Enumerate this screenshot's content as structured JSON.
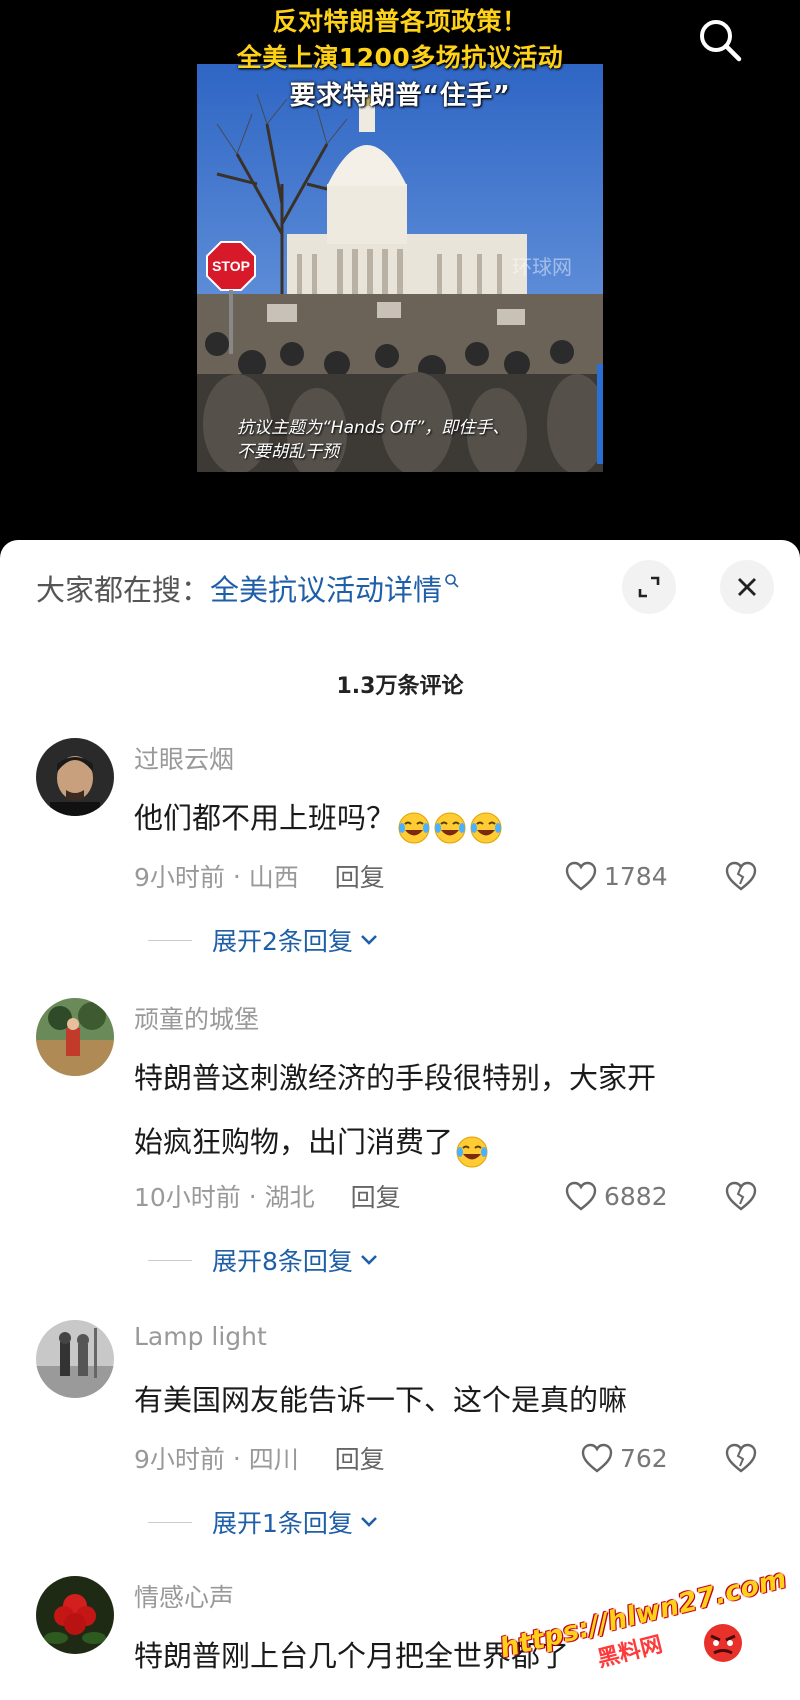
{
  "video": {
    "headline_lines": [
      "反对特朗普各项政策！",
      "全美上演1200多场抗议活动",
      "要求特朗普“住手”"
    ],
    "caption_lines": [
      "抗议主题为“Hands Off”，即住手、",
      "不要胡乱干预"
    ],
    "sign_text": "STOP",
    "watermark_text": "环球网"
  },
  "trending": {
    "label": "大家都在搜：",
    "query": "全美抗议活动详情"
  },
  "comments_header": "1.3万条评论",
  "comments": [
    {
      "user": "过眼云烟",
      "text": "他们都不用上班吗？",
      "emoji": [
        "laugh-cry",
        "laugh-cry",
        "laugh-cry"
      ],
      "time": "9小时前",
      "location": "山西",
      "reply_label": "回复",
      "likes": "1784",
      "expand_label": "展开2条回复"
    },
    {
      "user": "顽童的城堡",
      "text_lines": [
        "特朗普这刺激经济的手段很特别，大家开",
        "始疯狂购物，出门消费了"
      ],
      "emoji": [
        "laugh-cry"
      ],
      "time": "10小时前",
      "location": "湖北",
      "reply_label": "回复",
      "likes": "6882",
      "expand_label": "展开8条回复"
    },
    {
      "user": "Lamp light",
      "text": "有美国网友能告诉一下、这个是真的嘛",
      "time": "9小时前",
      "location": "四川",
      "reply_label": "回复",
      "likes": "762",
      "expand_label": "展开1条回复"
    },
    {
      "user": "情感心声",
      "text": "特朗普刚上台几个月把全世界都",
      "text_tail": "了"
    }
  ],
  "overlay_watermark": {
    "url": "https://hlwn27.com",
    "name": "黑料网"
  },
  "colors": {
    "link": "#1f5fa8",
    "headline_yellow": "#ffd21a",
    "muted": "#999999"
  },
  "icons": [
    "search-icon",
    "expand-icon",
    "close-icon",
    "heart-icon",
    "broken-heart-icon",
    "chevron-down-icon",
    "laugh-cry-emoji",
    "angry-emoji"
  ]
}
